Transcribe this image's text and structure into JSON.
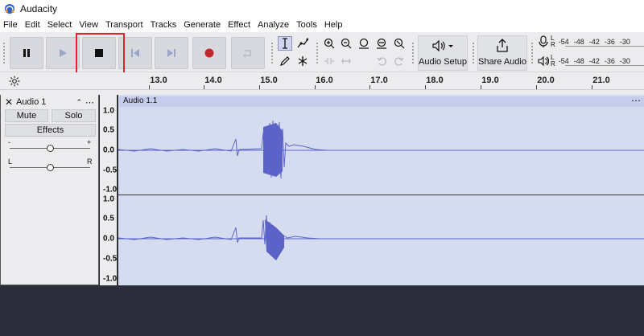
{
  "window": {
    "title": "Audacity"
  },
  "menu": [
    "File",
    "Edit",
    "Select",
    "View",
    "Transport",
    "Tracks",
    "Generate",
    "Effect",
    "Analyze",
    "Tools",
    "Help"
  ],
  "toolbar": {
    "audio_setup_label": "Audio Setup",
    "share_audio_label": "Share Audio",
    "meter_play": {
      "lr": "L\nR",
      "scale": [
        "-54",
        "-48",
        "-42",
        "-36",
        "-30"
      ]
    },
    "meter_rec": {
      "lr": "L\nR",
      "scale": [
        "-54",
        "-48",
        "-42",
        "-36",
        "-30"
      ]
    }
  },
  "ruler": {
    "ticks": [
      "13.0",
      "14.0",
      "15.0",
      "16.0",
      "17.0",
      "18.0",
      "19.0",
      "20.0",
      "21.0"
    ]
  },
  "track": {
    "name": "Audio 1",
    "mute_label": "Mute",
    "solo_label": "Solo",
    "effects_label": "Effects",
    "gain_minus": "-",
    "gain_plus": "+",
    "pan_left": "L",
    "pan_right": "R",
    "clip_name": "Audio 1.1",
    "scale_top": [
      "1.0",
      "0.5",
      "0.0",
      "-0.5",
      "-1.0"
    ],
    "scale_bottom": [
      "1.0",
      "0.5",
      "0.0",
      "-0.5",
      "-1.0"
    ]
  },
  "colors": {
    "waveform": "#5b63c9",
    "clip_header": "#c6ccec",
    "highlight": "#e0262a",
    "record": "#c2272d"
  }
}
